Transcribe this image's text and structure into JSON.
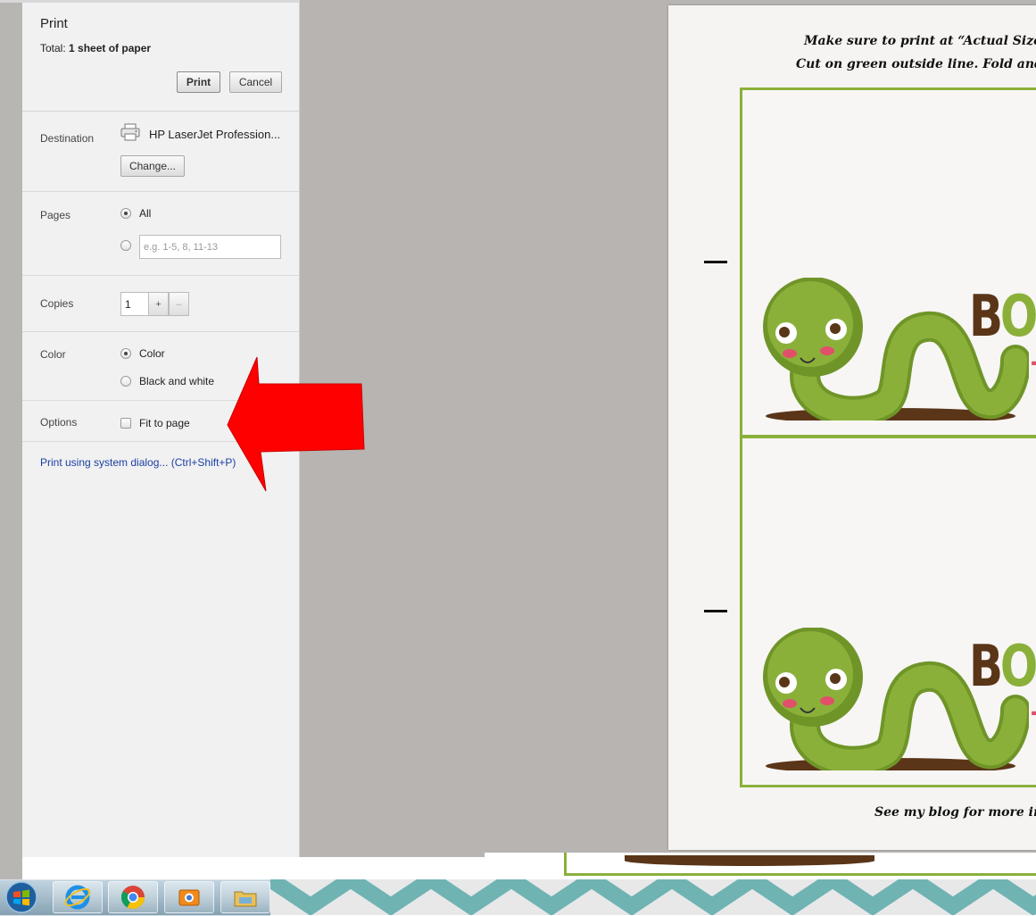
{
  "print_panel": {
    "title": "Print",
    "total_label": "Total:",
    "total_value": "1 sheet of paper",
    "print_button": "Print",
    "cancel_button": "Cancel",
    "destination": {
      "label": "Destination",
      "printer_name": "HP LaserJet Profession...",
      "change_button": "Change..."
    },
    "pages": {
      "label": "Pages",
      "all_label": "All",
      "all_selected": true,
      "range_placeholder": "e.g. 1-5, 8, 11-13"
    },
    "copies": {
      "label": "Copies",
      "value": "1",
      "plus": "+",
      "minus": "–"
    },
    "color": {
      "label": "Color",
      "options": [
        "Color",
        "Black and white"
      ],
      "selected": "Color"
    },
    "options": {
      "label": "Options",
      "fit_to_page": "Fit to page",
      "fit_to_page_checked": false
    },
    "system_dialog_link": "Print using system dialog... (Ctrl+Shift+P)"
  },
  "preview": {
    "instruction_line1": "Make sure to print at “Actual Size”.  Sec",
    "instruction_line2": "Cut on green outside line.  Fold and staple",
    "footer_note": "See my blog for more inform",
    "card_title_part1": "B",
    "card_title_part2": "O",
    "card_title_part3": "O",
    "card_subtitle_char": "T"
  },
  "taskbar": {
    "items": [
      "start-button",
      "internet-explorer-icon",
      "chrome-icon",
      "photo-app-icon",
      "file-explorer-icon"
    ]
  },
  "colors": {
    "panel_bg": "#f1f1f1",
    "preview_bg": "#b7b4b1",
    "link_blue": "#1a3fa3",
    "arrow_red": "#ff0000",
    "card_border_green": "#8bb03a",
    "worm_green": "#7da330",
    "mud_brown": "#5a3518",
    "boo_pink": "#e0506a"
  }
}
